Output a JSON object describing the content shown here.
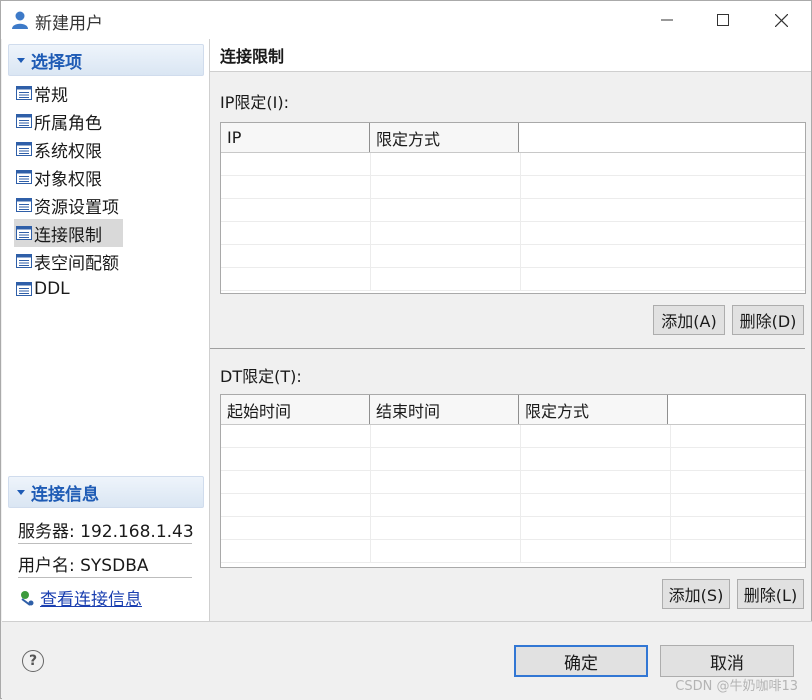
{
  "window": {
    "title": "新建用户"
  },
  "sidebar": {
    "section_title": "选择项",
    "items": [
      {
        "label": "常规"
      },
      {
        "label": "所属角色"
      },
      {
        "label": "系统权限"
      },
      {
        "label": "对象权限"
      },
      {
        "label": "资源设置项"
      },
      {
        "label": "连接限制"
      },
      {
        "label": "表空间配额"
      },
      {
        "label": "DDL"
      }
    ],
    "selected": "连接限制"
  },
  "connection_info": {
    "section_title": "连接信息",
    "server": "服务器: 192.168.1.43",
    "user": "用户名: SYSDBA",
    "link": "查看连接信息"
  },
  "main": {
    "header": "连接限制",
    "ip_group": {
      "label": "IP限定(I):",
      "columns": [
        "IP",
        "限定方式"
      ],
      "add_label": "添加(A)",
      "delete_label": "删除(D)"
    },
    "dt_group": {
      "label": "DT限定(T):",
      "columns": [
        "起始时间",
        "结束时间",
        "限定方式"
      ],
      "add_label": "添加(S)",
      "delete_label": "删除(L)"
    }
  },
  "footer": {
    "ok_label": "确定",
    "cancel_label": "取消",
    "watermark": "CSDN @牛奶咖啡13"
  },
  "colors": {
    "accent": "#1e5bb5",
    "link": "#1a3fb0",
    "default_button_border": "#3277d4"
  }
}
